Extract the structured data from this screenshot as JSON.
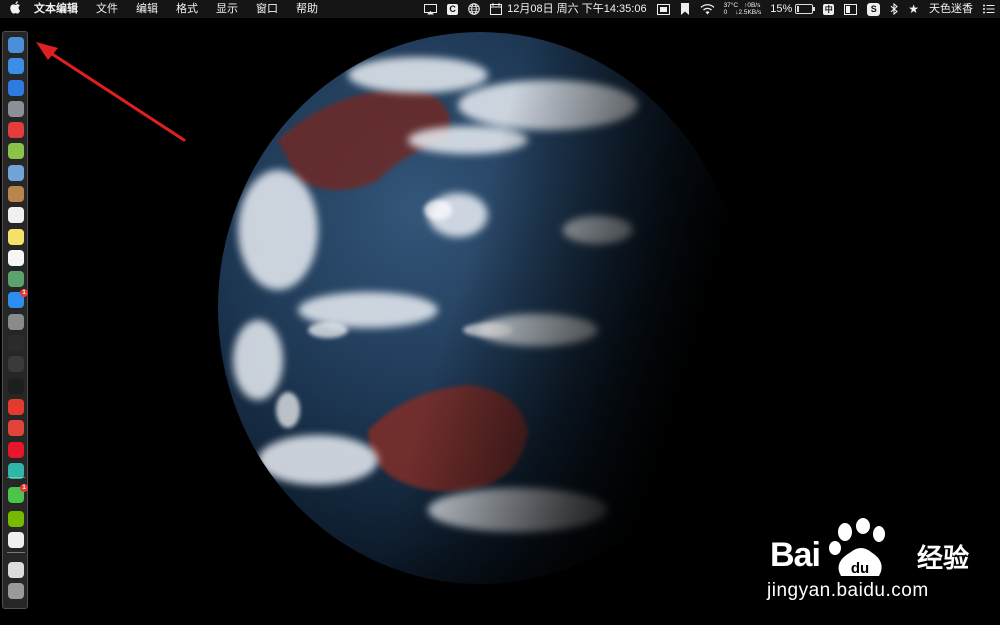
{
  "menubar": {
    "apple_glyph": "",
    "app_name": "文本编辑",
    "items": [
      "文件",
      "编辑",
      "格式",
      "显示",
      "窗口",
      "帮助"
    ],
    "status": {
      "c_icon": "C",
      "datetime": "12月08日 周六 下午14:35:06",
      "temperature": "37°C",
      "fan": "0",
      "net_up": "↑0B/s",
      "net_down": "↓2.5KB/s",
      "battery": "15%",
      "battery_level": 0.15,
      "input_method": "中",
      "sogou_icon": "S",
      "user_name": "天色迷香"
    }
  },
  "dock": {
    "icons": [
      {
        "name": "finder-icon",
        "color": "#4a90d9"
      },
      {
        "name": "safari-globe-icon",
        "color": "#3b8ee6"
      },
      {
        "name": "safari-compass-icon",
        "color": "#2e7be0"
      },
      {
        "name": "launchpad-rocket-icon",
        "color": "#8a8f98"
      },
      {
        "name": "red-app-icon",
        "color": "#e43b3b"
      },
      {
        "name": "android-icon",
        "color": "#8bc34a"
      },
      {
        "name": "preview-photo-icon",
        "color": "#6fa4d8"
      },
      {
        "name": "contacts-book-icon",
        "color": "#b8864b"
      },
      {
        "name": "textedit-icon",
        "color": "#f0f0f0"
      },
      {
        "name": "notes-icon",
        "color": "#f5e26b"
      },
      {
        "name": "reminders-icon",
        "color": "#f7f7f7"
      },
      {
        "name": "maps-icon",
        "color": "#5aa36b"
      },
      {
        "name": "app-store-icon",
        "color": "#2e8ef0"
      },
      {
        "name": "system-preferences-icon",
        "color": "#8a8a8a"
      },
      {
        "name": "activity-monitor-icon",
        "color": "#2b2b2b"
      },
      {
        "name": "console-icon",
        "color": "#3a3a3a"
      },
      {
        "name": "terminal-icon",
        "color": "#1e1e1e"
      },
      {
        "name": "yandex-browser-icon",
        "color": "#e63a2e"
      },
      {
        "name": "vivaldi-icon",
        "color": "#e0443a"
      },
      {
        "name": "weibo-icon",
        "color": "#e6162d"
      },
      {
        "name": "green-circle-app-icon",
        "color": "#2fb6a8"
      },
      {
        "name": "wechat-icon",
        "color": "#4cc34a"
      },
      {
        "name": "nvidia-icon",
        "color": "#76b900"
      },
      {
        "name": "document-editor-icon",
        "color": "#efefef"
      },
      {
        "name": "downloads-stack-icon",
        "color": "#dcdcdc"
      },
      {
        "name": "trash-icon",
        "color": "#9a9a9a"
      }
    ],
    "badges": {
      "app_store": "1",
      "wechat": "1"
    }
  },
  "watermark": {
    "brand": "Bai",
    "brand_suffix": "经验",
    "paw_text": "du",
    "url": "jingyan.baidu.com"
  },
  "colors": {
    "menubar_bg": "#151515",
    "arrow": "#e02020",
    "ocean": "#1d3550",
    "land_red": "#7a2e2a"
  }
}
